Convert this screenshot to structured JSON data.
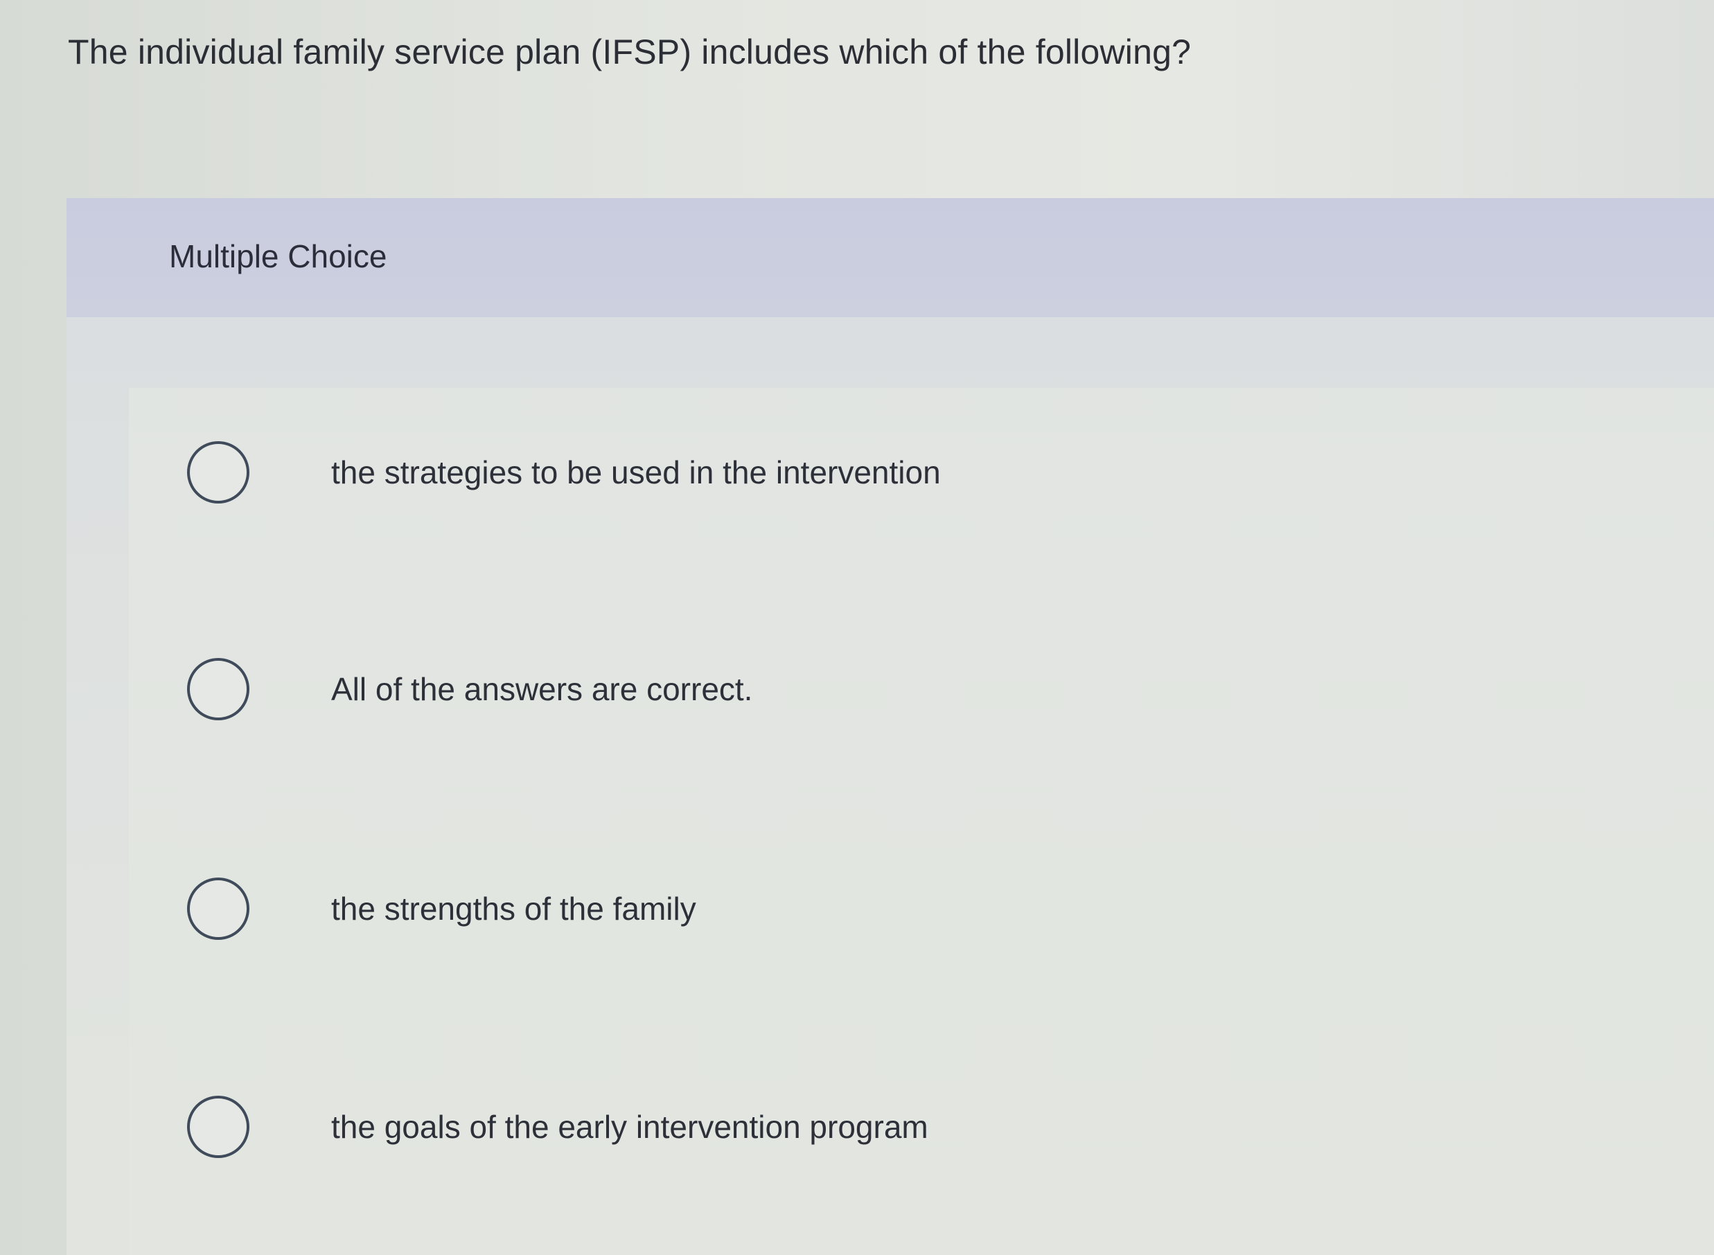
{
  "question": {
    "text": "The individual family service plan (IFSP) includes which of the following?"
  },
  "panel": {
    "label": "Multiple Choice"
  },
  "options": [
    {
      "label": "the strategies to be used in the intervention",
      "selected": false
    },
    {
      "label": "All of the answers are correct.",
      "selected": false
    },
    {
      "label": "the strengths of the family",
      "selected": false
    },
    {
      "label": "the goals of the early intervention program",
      "selected": false
    }
  ],
  "colors": {
    "background": "#dfe3dd",
    "header_band": "#c9ccdf",
    "radio_border": "#3f4a5a",
    "text": "#2b2e35"
  }
}
